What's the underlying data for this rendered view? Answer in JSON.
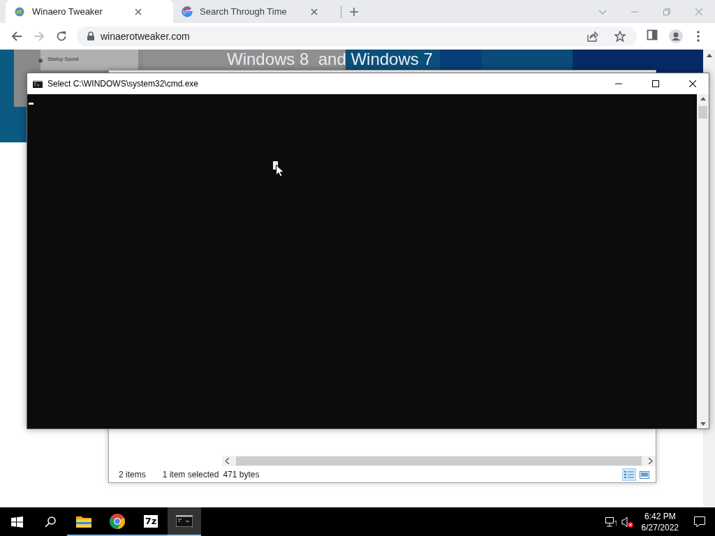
{
  "browser": {
    "tabs": [
      {
        "title": "Winaero Tweaker",
        "kind": "site",
        "selected": true
      },
      {
        "title": "Search Through Time",
        "kind": "google",
        "selected": false
      }
    ],
    "address": "winaerotweaker.com"
  },
  "page": {
    "banner_heading": "Windows 8  and Windows 7",
    "banner_sidebar_items": [
      "Startup Sound"
    ]
  },
  "explorer": {
    "status_items": [
      "2 items",
      "1 item selected",
      "471 bytes"
    ],
    "views": [
      {
        "kind": "details",
        "selected": true
      },
      {
        "kind": "preview",
        "selected": false
      }
    ]
  },
  "console": {
    "title": "Select C:\\WINDOWS\\system32\\cmd.exe"
  },
  "taskbar": {
    "apps": [
      {
        "kind": "explorer",
        "active": false
      },
      {
        "kind": "chrome",
        "active": false
      },
      {
        "kind": "archiver",
        "label": "7z",
        "active": false
      },
      {
        "kind": "console",
        "active": true
      }
    ],
    "time": "6:42 PM",
    "date": "6/27/2022"
  }
}
